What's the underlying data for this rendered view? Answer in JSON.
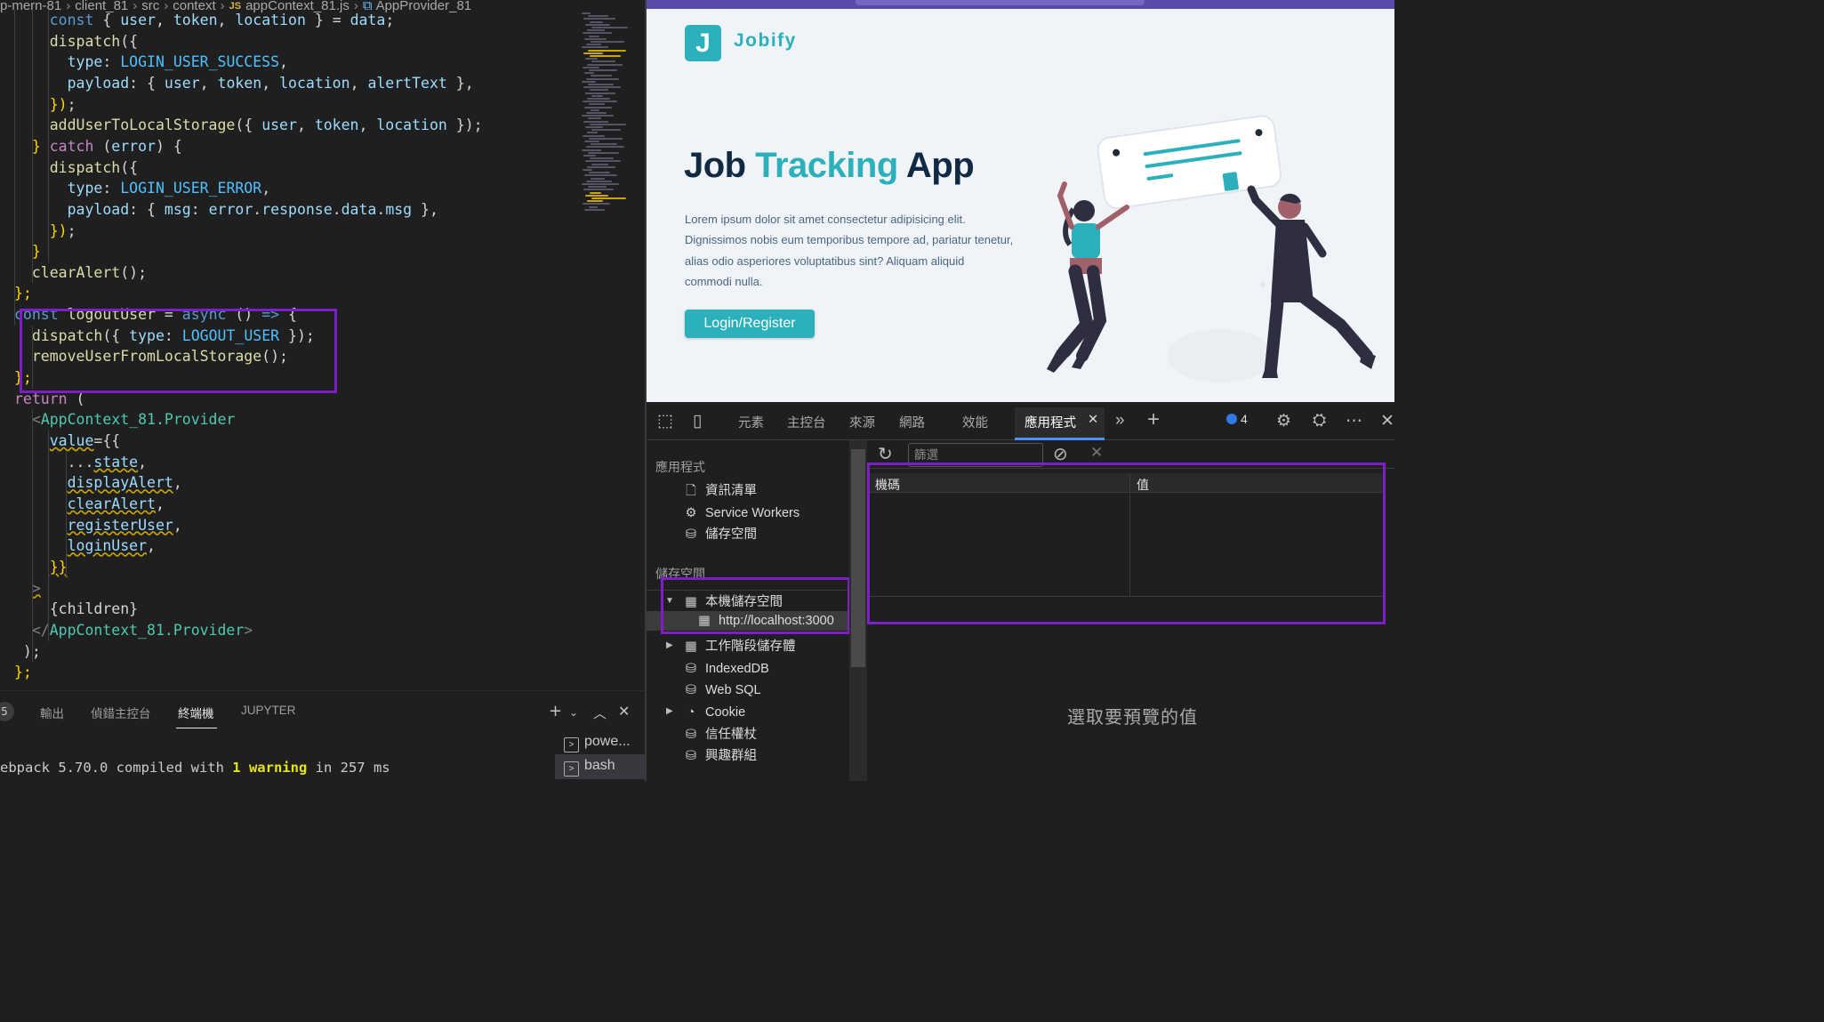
{
  "editor": {
    "breadcrumb": {
      "parts": [
        "p-mern-81",
        "client_81",
        "src",
        "context"
      ],
      "js_tag": "JS",
      "file": "appContext_81.js",
      "symbol": "AppProvider_81"
    },
    "code_lines": [
      [
        [
          "p",
          "    "
        ],
        [
          "k",
          "const"
        ],
        [
          "p",
          " { "
        ],
        [
          "v",
          "user"
        ],
        [
          "p",
          ", "
        ],
        [
          "v",
          "token"
        ],
        [
          "p",
          ", "
        ],
        [
          "v",
          "location"
        ],
        [
          "p",
          " } = "
        ],
        [
          "v",
          "data"
        ],
        [
          "p",
          ";"
        ]
      ],
      [
        [
          "p",
          "    "
        ],
        [
          "f",
          "dispatch"
        ],
        [
          "p",
          "({"
        ]
      ],
      [
        [
          "p",
          "      "
        ],
        [
          "v",
          "type"
        ],
        [
          "p",
          ": "
        ],
        [
          "c",
          "LOGIN_USER_SUCCESS"
        ],
        [
          "p",
          ","
        ]
      ],
      [
        [
          "p",
          "      "
        ],
        [
          "v",
          "payload"
        ],
        [
          "p",
          ": { "
        ],
        [
          "v",
          "user"
        ],
        [
          "p",
          ", "
        ],
        [
          "v",
          "token"
        ],
        [
          "p",
          ", "
        ],
        [
          "v",
          "location"
        ],
        [
          "p",
          ", "
        ],
        [
          "v",
          "alertText"
        ],
        [
          "p",
          " },"
        ]
      ],
      [
        [
          "p",
          "    "
        ],
        [
          "y",
          "})"
        ],
        [
          "p",
          ";"
        ]
      ],
      [
        [
          "p",
          "    "
        ],
        [
          "f",
          "addUserToLocalStorage"
        ],
        [
          "p",
          "({ "
        ],
        [
          "v",
          "user"
        ],
        [
          "p",
          ", "
        ],
        [
          "v",
          "token"
        ],
        [
          "p",
          ", "
        ],
        [
          "v",
          "location"
        ],
        [
          "p",
          " });"
        ]
      ],
      [
        [
          "p",
          "  "
        ],
        [
          "y",
          "}"
        ],
        [
          "p",
          " "
        ],
        [
          "m",
          "catch"
        ],
        [
          "p",
          " ("
        ],
        [
          "v",
          "error"
        ],
        [
          "p",
          ") {"
        ]
      ],
      [
        [
          "p",
          "    "
        ],
        [
          "f",
          "dispatch"
        ],
        [
          "p",
          "({"
        ]
      ],
      [
        [
          "p",
          "      "
        ],
        [
          "v",
          "type"
        ],
        [
          "p",
          ": "
        ],
        [
          "c",
          "LOGIN_USER_ERROR"
        ],
        [
          "p",
          ","
        ]
      ],
      [
        [
          "p",
          "      "
        ],
        [
          "v",
          "payload"
        ],
        [
          "p",
          ": { "
        ],
        [
          "v",
          "msg"
        ],
        [
          "p",
          ": "
        ],
        [
          "v",
          "error"
        ],
        [
          "p",
          "."
        ],
        [
          "v",
          "response"
        ],
        [
          "p",
          "."
        ],
        [
          "v",
          "data"
        ],
        [
          "p",
          "."
        ],
        [
          "v",
          "msg"
        ],
        [
          "p",
          " },"
        ]
      ],
      [
        [
          "p",
          "    "
        ],
        [
          "y",
          "})"
        ],
        [
          "p",
          ";"
        ]
      ],
      [
        [
          "p",
          "  "
        ],
        [
          "y",
          "}"
        ]
      ],
      [
        [
          "p",
          "  "
        ],
        [
          "f",
          "clearAlert"
        ],
        [
          "p",
          "();"
        ]
      ],
      [
        [
          "y",
          "};"
        ]
      ],
      [
        [
          "k",
          "const"
        ],
        [
          "p",
          " "
        ],
        [
          "f",
          "logoutUser"
        ],
        [
          "p",
          " = "
        ],
        [
          "k",
          "async"
        ],
        [
          "p",
          " () "
        ],
        [
          "k",
          "=>"
        ],
        [
          "p",
          " {"
        ]
      ],
      [
        [
          "p",
          "  "
        ],
        [
          "f",
          "dispatch"
        ],
        [
          "p",
          "({ "
        ],
        [
          "v",
          "type"
        ],
        [
          "p",
          ": "
        ],
        [
          "c",
          "LOGOUT_USER"
        ],
        [
          "p",
          " });"
        ]
      ],
      [
        [
          "p",
          "  "
        ],
        [
          "f",
          "removeUserFromLocalStorage"
        ],
        [
          "p",
          "();"
        ]
      ],
      [
        [
          "y",
          "};"
        ]
      ],
      [
        [
          "m",
          "return"
        ],
        [
          "p",
          " ("
        ]
      ],
      [
        [
          "p",
          "  "
        ],
        [
          "g",
          "<"
        ],
        [
          "t",
          "AppContext_81.Provider"
        ]
      ],
      [
        [
          "p",
          "    "
        ],
        [
          "v",
          "value"
        ],
        [
          "p",
          "={{"
        ]
      ],
      [
        [
          "p",
          "      ..."
        ],
        [
          "v",
          "state"
        ],
        [
          "p",
          ","
        ]
      ],
      [
        [
          "p",
          "      "
        ],
        [
          "v",
          "displayAlert"
        ],
        [
          "p",
          ","
        ]
      ],
      [
        [
          "p",
          "      "
        ],
        [
          "v",
          "clearAlert"
        ],
        [
          "p",
          ","
        ]
      ],
      [
        [
          "p",
          "      "
        ],
        [
          "v",
          "registerUser"
        ],
        [
          "p",
          ","
        ]
      ],
      [
        [
          "p",
          "      "
        ],
        [
          "v",
          "loginUser"
        ],
        [
          "p",
          ","
        ]
      ],
      [
        [
          "p",
          "    "
        ],
        [
          "y",
          "}}"
        ]
      ],
      [
        [
          "p",
          "  "
        ],
        [
          "g",
          ">"
        ]
      ],
      [
        [
          "p",
          "    "
        ],
        [
          "p",
          "{children}"
        ]
      ],
      [
        [
          "p",
          "  "
        ],
        [
          "g",
          "</"
        ],
        [
          "t",
          "AppContext_81.Provider"
        ],
        [
          "g",
          ">"
        ]
      ],
      [
        [
          "p",
          " );"
        ]
      ],
      [
        [
          "y",
          "};"
        ]
      ]
    ],
    "colors": {
      "k": "#569cd6",
      "f": "#dcdcaa",
      "v": "#9cdcfe",
      "c": "#4fc1ff",
      "m": "#c586c0",
      "p": "#d4d4d4",
      "y": "#ffd700",
      "t": "#4ec9b0",
      "g": "#808080"
    },
    "highlight_color": "#7d1fc7"
  },
  "panel": {
    "badge": "5",
    "tabs": [
      "輸出",
      "偵錯主控台",
      "終端機",
      "JUPYTER"
    ],
    "active_tab": "終端機",
    "terminals": [
      "powe...",
      "bash"
    ],
    "output": [
      "ebpack 5.70.0 compiled with ",
      "1 warning",
      " in 257 ms"
    ]
  },
  "site": {
    "logo_letter": "J",
    "logo_text": "Jobify",
    "title_part1": "Job ",
    "title_accent": "Tracking",
    "title_part2": " App",
    "text": "Lorem ipsum dolor sit amet consectetur adipisicing elit. Dignissimos nobis eum temporibus tempore ad, pariatur tenetur, alias odio asperiores voluptatibus sint? Aliquam aliquid commodi nulla.",
    "button": "Login/Register",
    "accent_color": "#2cb1bc"
  },
  "devtools": {
    "tabs": [
      "元素",
      "主控台",
      "來源",
      "網路",
      "效能",
      "應用程式"
    ],
    "active_tab": "應用程式",
    "issues_count": "4",
    "sidebar": {
      "app_section": "應用程式",
      "app_items": [
        "資訊清單",
        "Service Workers",
        "儲存空間"
      ],
      "storage_section": "儲存空間",
      "local_storage": "本機儲存空間",
      "localhost": "http://localhost:3000",
      "session_storage": "工作階段儲存體",
      "storage_items": [
        "IndexedDB",
        "Web SQL",
        "Cookie",
        "信任權杖",
        "興趣群組"
      ]
    },
    "filter_placeholder": "篩選",
    "table_headers": [
      "機碼",
      "值"
    ],
    "empty_message": "選取要預覽的值"
  }
}
